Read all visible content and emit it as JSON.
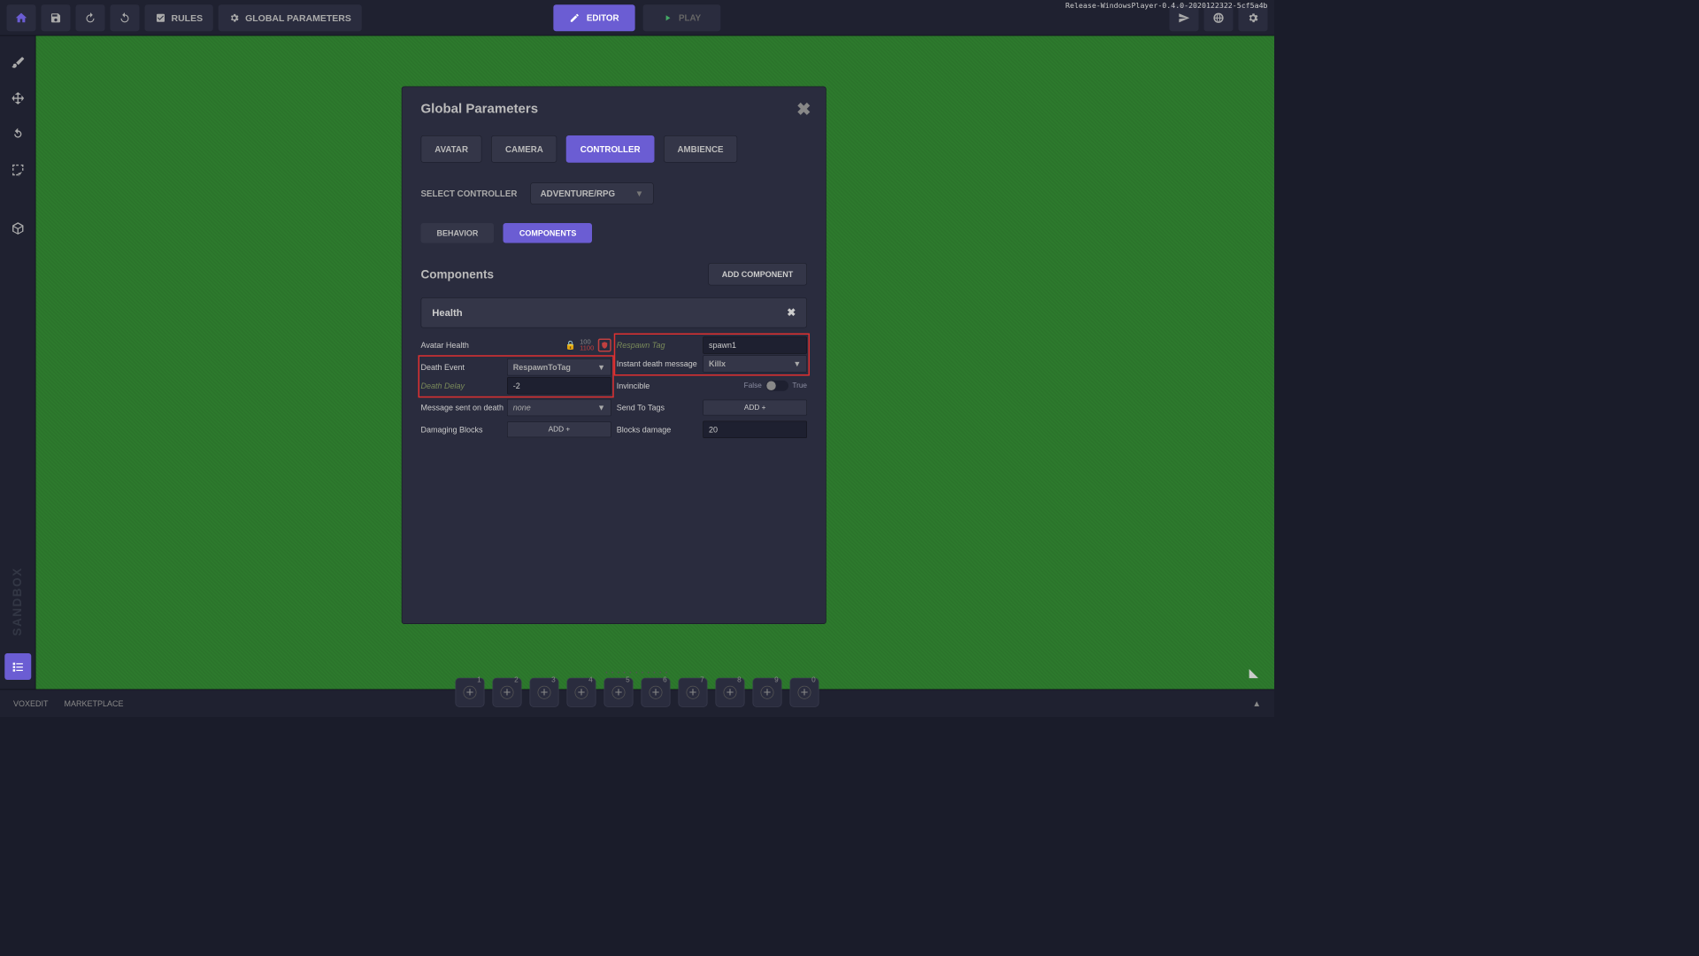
{
  "version": "Release-WindowsPlayer-0.4.0-2020122322-5cf5a4b",
  "topbar": {
    "rules": "RULES",
    "globalParams": "GLOBAL PARAMETERS",
    "editor": "EDITOR",
    "play": "PLAY"
  },
  "sidebar": {
    "logo": "SANDBOX"
  },
  "bottombar": {
    "voxedit": "VOXEDIT",
    "marketplace": "MARKETPLACE",
    "slots": [
      "1",
      "2",
      "3",
      "4",
      "5",
      "6",
      "7",
      "8",
      "9",
      "0"
    ]
  },
  "modal": {
    "title": "Global Parameters",
    "tabs": {
      "avatar": "AVATAR",
      "camera": "CAMERA",
      "controller": "CONTROLLER",
      "ambience": "AMBIENCE"
    },
    "selectController": "SELECT CONTROLLER",
    "controllerValue": "ADVENTURE/RPG",
    "subtabs": {
      "behavior": "BEHAVIOR",
      "components": "COMPONENTS"
    },
    "componentsHeader": "Components",
    "addComponent": "ADD COMPONENT",
    "health": {
      "title": "Health",
      "left": {
        "avatarHealth": "Avatar Health",
        "avatarHealthTop": "100",
        "avatarHealthBot": "1100",
        "deathEvent": "Death Event",
        "deathEventValue": "RespawnToTag",
        "deathDelay": "Death Delay",
        "deathDelayValue": "-2",
        "msgOnDeath": "Message sent on death",
        "msgOnDeathValue": "none",
        "damagingBlocks": "Damaging Blocks",
        "addBtn": "ADD +"
      },
      "right": {
        "respawnTag": "Respawn Tag",
        "respawnTagValue": "spawn1",
        "instantDeath": "Instant death message",
        "instantDeathValue": "Killx",
        "invincible": "Invincible",
        "false": "False",
        "true": "True",
        "sendToTags": "Send To Tags",
        "addBtn": "ADD +",
        "blocksDamage": "Blocks damage",
        "blocksDamageValue": "20"
      }
    }
  }
}
